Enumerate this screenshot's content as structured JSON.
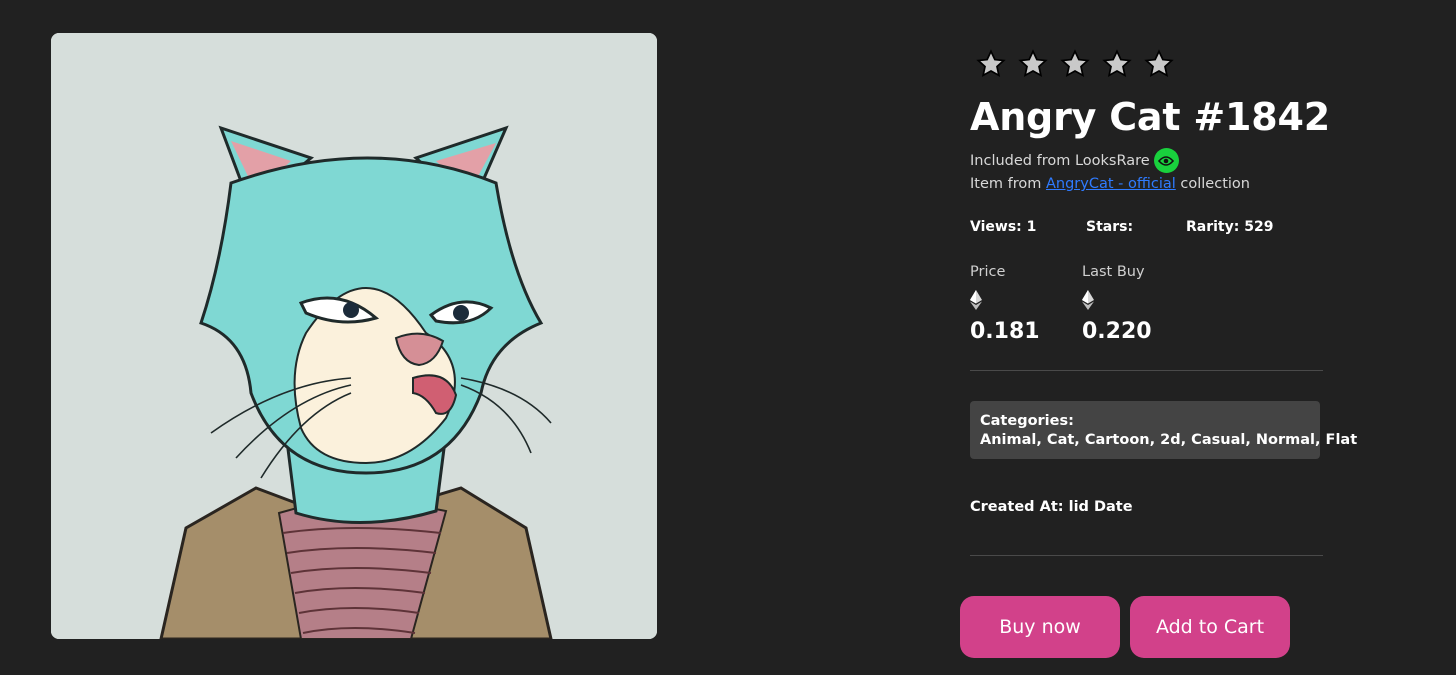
{
  "item": {
    "title": "Angry Cat #1842",
    "included_text": "Included from LooksRare",
    "collection_prefix": "Item from",
    "collection_link": "AngryCat - official",
    "collection_suffix": "collection",
    "rating_stars": 5
  },
  "stats": {
    "views": "Views: 1",
    "stars": "Stars:",
    "rarity": "Rarity: 529"
  },
  "pricing": {
    "price_label": "Price",
    "price_value": "0.181",
    "last_buy_label": "Last Buy",
    "last_buy_value": "0.220"
  },
  "categories": {
    "label": "Categories:",
    "list": "Animal, Cat, Cartoon, 2d, Casual, Normal, Flat"
  },
  "created": "Created At: lid Date",
  "actions": {
    "buy": "Buy now",
    "cart": "Add to Cart"
  },
  "colors": {
    "background": "#212121",
    "accent_button": "#d2418a",
    "link": "#2f7bff",
    "badge_green": "#19d13d",
    "panel": "#444444"
  },
  "icons": [
    "star-icon",
    "eye-icon",
    "ethereum-icon"
  ]
}
